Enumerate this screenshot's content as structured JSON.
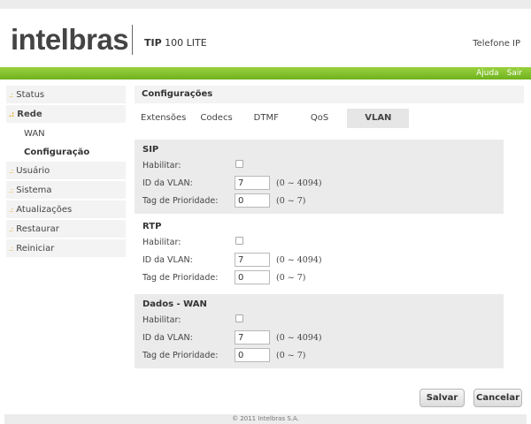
{
  "brand": {
    "logo_text": "intelbras",
    "product_bold": "TIP",
    "product_rest": "100 LITE",
    "device_label": "Telefone IP"
  },
  "topnav": {
    "help": "Ajuda",
    "logout": "Sair"
  },
  "sidebar": {
    "bullet": ".:",
    "items": [
      {
        "label": "Status"
      },
      {
        "label": "Rede"
      },
      {
        "label": "Usuário"
      },
      {
        "label": "Sistema"
      },
      {
        "label": "Atualizações"
      },
      {
        "label": "Restaurar"
      },
      {
        "label": "Reiniciar"
      }
    ],
    "rede_sub": [
      {
        "label": "WAN"
      },
      {
        "label": "Configuração"
      }
    ]
  },
  "main": {
    "title": "Configurações",
    "tabs": [
      {
        "label": "Extensões"
      },
      {
        "label": "Codecs"
      },
      {
        "label": "DTMF"
      },
      {
        "label": "QoS"
      },
      {
        "label": "VLAN"
      }
    ],
    "sections": [
      {
        "title": "SIP",
        "enable_label": "Habilitar:",
        "enabled": false,
        "vlan_label": "ID da VLAN:",
        "vlan_value": "7",
        "vlan_range": "(0 ~ 4094)",
        "prio_label": "Tag de Prioridade:",
        "prio_value": "0",
        "prio_range": "(0 ~ 7)"
      },
      {
        "title": "RTP",
        "enable_label": "Habilitar:",
        "enabled": false,
        "vlan_label": "ID da VLAN:",
        "vlan_value": "7",
        "vlan_range": "(0 ~ 4094)",
        "prio_label": "Tag de Prioridade:",
        "prio_value": "0",
        "prio_range": "(0 ~ 7)"
      },
      {
        "title": "Dados - WAN",
        "enable_label": "Habilitar:",
        "enabled": false,
        "vlan_label": "ID da VLAN:",
        "vlan_value": "7",
        "vlan_range": "(0 ~ 4094)",
        "prio_label": "Tag de Prioridade:",
        "prio_value": "0",
        "prio_range": "(0 ~ 7)"
      }
    ],
    "save_label": "Salvar",
    "cancel_label": "Cancelar"
  },
  "footer": {
    "copyright": "© 2011 Intelbras S.A."
  },
  "colors": {
    "accent_green": "#7ec12b",
    "panel_gray": "#ebebeb",
    "bullet_orange": "#e0a000"
  }
}
